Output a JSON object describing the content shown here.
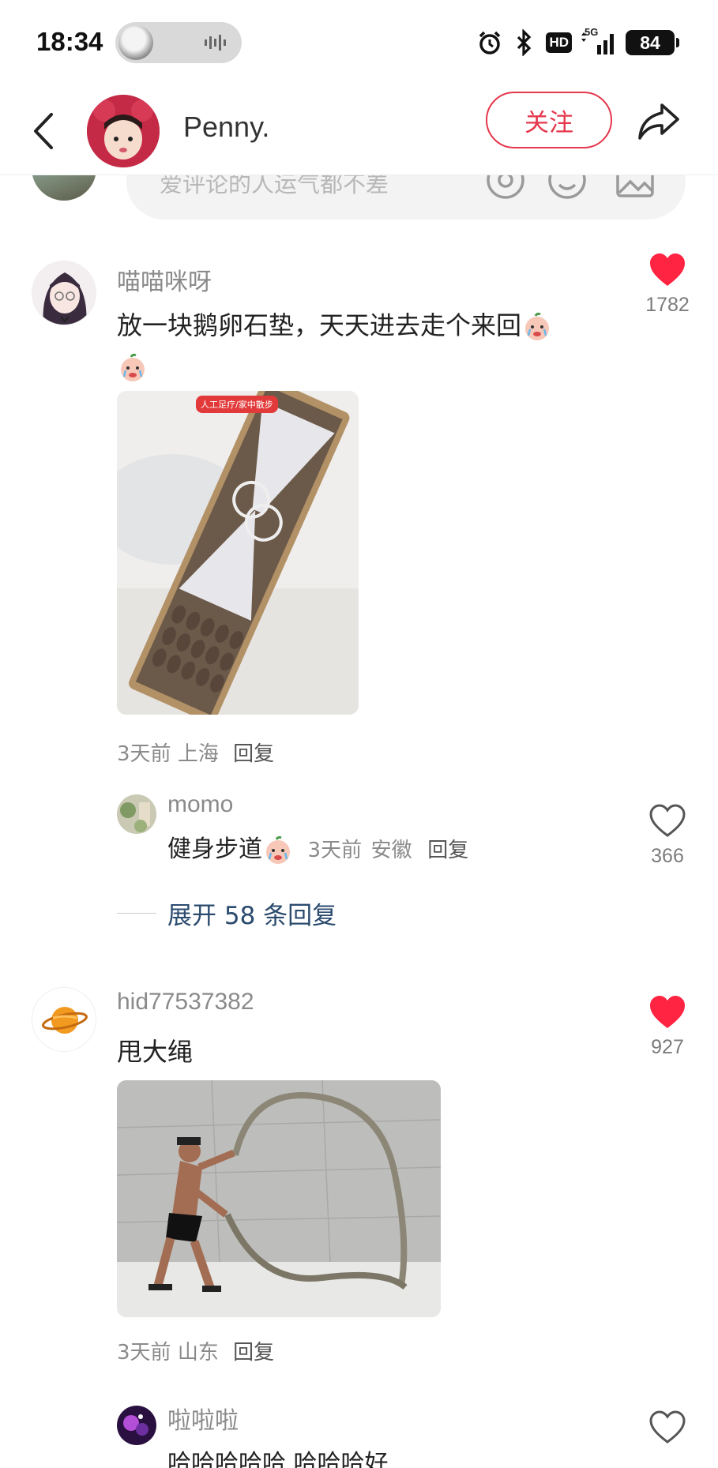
{
  "status_bar": {
    "time": "18:34",
    "network_badge": "HD",
    "signal_label": "5G",
    "battery": "84"
  },
  "header": {
    "author_name": "Penny.",
    "follow_label": "关注"
  },
  "comment_input": {
    "placeholder": "爱评论的人运气都不差"
  },
  "comments": [
    {
      "user": "喵喵咪呀",
      "text": "放一块鹅卵石垫，天天进去走个来回",
      "likes": "1782",
      "liked": true,
      "image_badge": "人工足疗/家中散步",
      "time": "3天前",
      "location": "上海",
      "reply_label": "回复",
      "sub_reply": {
        "user": "momo",
        "text": "健身步道",
        "time": "3天前",
        "location": "安徽",
        "reply_label": "回复",
        "likes": "366",
        "liked": false
      },
      "expand_label": "展开 58 条回复"
    },
    {
      "user": "hid77537382",
      "text": "甩大绳",
      "likes": "927",
      "liked": true,
      "time": "3天前",
      "location": "山东",
      "reply_label": "回复"
    },
    {
      "user": "啦啦啦",
      "text": "哈哈哈哈哈    哈哈哈好",
      "liked": false
    }
  ],
  "colors": {
    "accent": "#e5374c",
    "like_red": "#ff2442",
    "expand_link": "#2a4a6e"
  }
}
